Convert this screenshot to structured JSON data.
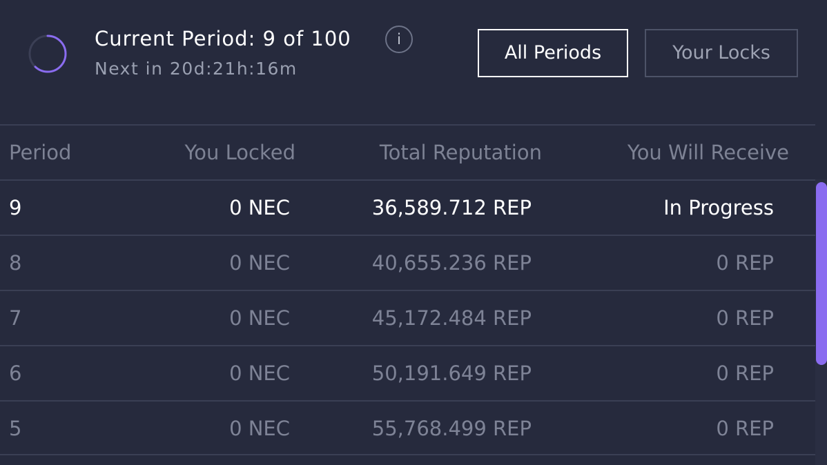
{
  "header": {
    "current_period": "Current Period: 9 of 100",
    "next_in": "Next in 20d:21h:16m",
    "info_label": "i",
    "period_progress": 0.62
  },
  "tabs": [
    {
      "label": "All Periods",
      "active": true
    },
    {
      "label": "Your Locks",
      "active": false
    }
  ],
  "table": {
    "columns": [
      "Period",
      "You Locked",
      "Total Reputation",
      "You Will Receive"
    ],
    "rows": [
      {
        "period": "9",
        "locked": "0 NEC",
        "total_rep": "36,589.712 REP",
        "receive": "In Progress"
      },
      {
        "period": "8",
        "locked": "0 NEC",
        "total_rep": "40,655.236 REP",
        "receive": "0 REP"
      },
      {
        "period": "7",
        "locked": "0 NEC",
        "total_rep": "45,172.484 REP",
        "receive": "0 REP"
      },
      {
        "period": "6",
        "locked": "0 NEC",
        "total_rep": "50,191.649 REP",
        "receive": "0 REP"
      },
      {
        "period": "5",
        "locked": "0 NEC",
        "total_rep": "55,768.499 REP",
        "receive": "0 REP"
      }
    ]
  },
  "colors": {
    "background": "#262a3d",
    "accent": "#8a6cf0",
    "text_primary": "#ffffff",
    "text_muted": "#7e8396"
  },
  "icons": {
    "progress": "progress-ring-icon",
    "info": "info-icon"
  }
}
